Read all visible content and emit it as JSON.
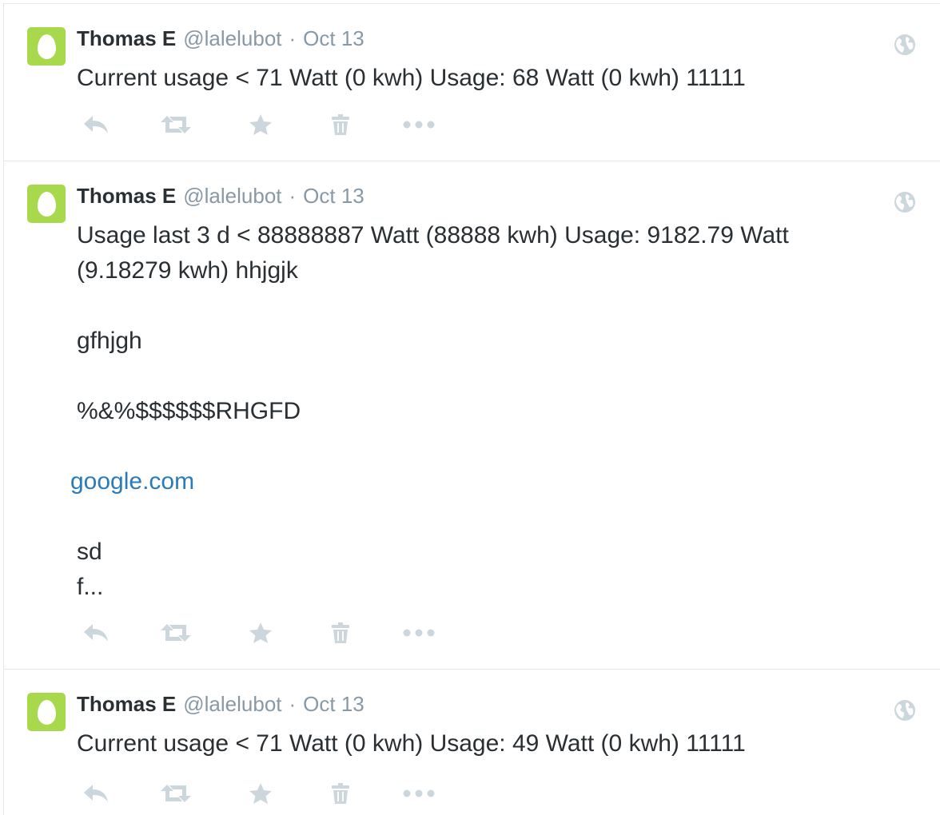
{
  "tweets": [
    {
      "fullname": "Thomas E",
      "handle": "@lalelubot",
      "separator": "·",
      "time": "Oct 13",
      "lines": [
        "Current usage < 71 Watt (0 kwh) Usage: 68 Watt (0 kwh) 11111"
      ]
    },
    {
      "fullname": "Thomas E",
      "handle": "@lalelubot",
      "separator": "·",
      "time": "Oct 13",
      "lines": [
        "Usage last 3 d < 88888887 Watt (88888 kwh) Usage: 9182.79 Watt",
        "(9.18279 kwh) hhjgjk",
        "gfhjgh",
        "%&%$$$$$$RHGFD",
        "google.com",
        "sd",
        "f..."
      ]
    },
    {
      "fullname": "Thomas E",
      "handle": "@lalelubot",
      "separator": "·",
      "time": "Oct 13",
      "lines": [
        "Current usage < 71 Watt (0 kwh) Usage: 49 Watt (0 kwh) 11111"
      ]
    }
  ],
  "colors": {
    "text": "#292f33",
    "secondary": "#8899a6",
    "link": "#2b7bb9",
    "icon": "#ccd6dd",
    "avatar_bg": "#a8d84c",
    "divider": "#e1e8ed"
  },
  "icons": {
    "globe": "globe-icon",
    "reply": "reply-icon",
    "retweet": "retweet-icon",
    "favorite": "star-icon",
    "delete": "trash-icon",
    "more": "more-dots-icon"
  }
}
